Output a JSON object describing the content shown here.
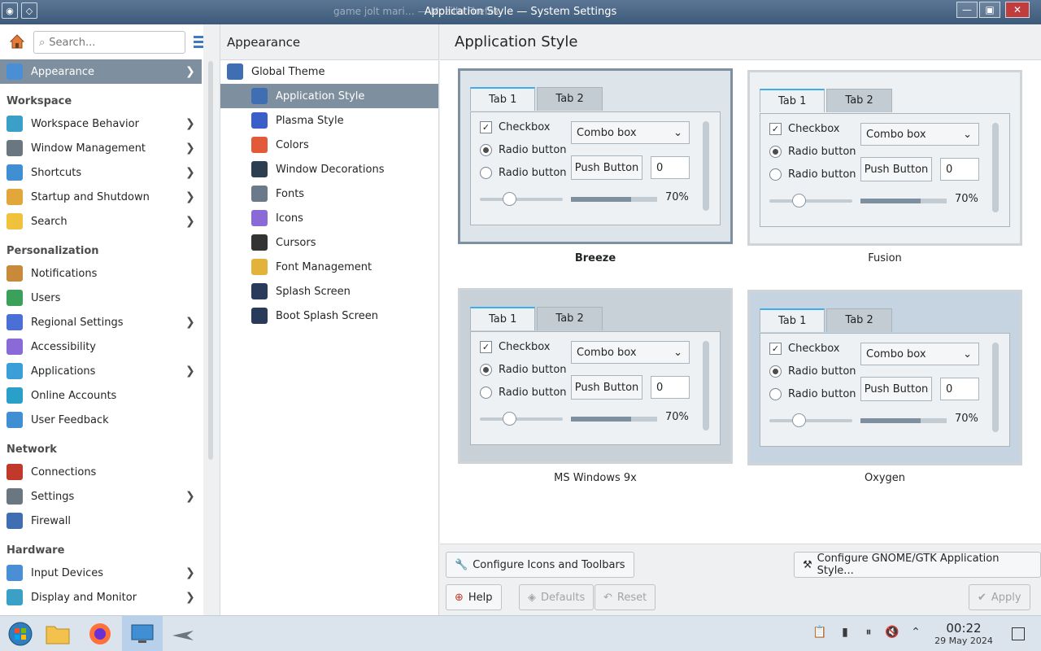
{
  "window": {
    "title": "Application Style — System Settings",
    "background_title": "game jolt mari… — Mozilla Firefox",
    "controls": {
      "minimize": "—",
      "maximize": "▣",
      "close": "✕"
    }
  },
  "sidebar": {
    "search_placeholder": "Search...",
    "items": [
      {
        "label": "Appearance",
        "active": true,
        "chevron": true,
        "icon": "appearance-icon"
      }
    ],
    "workspace_heading": "Workspace",
    "workspace": [
      {
        "label": "Workspace Behavior",
        "chevron": true,
        "icon": "workspace-behavior-icon"
      },
      {
        "label": "Window Management",
        "chevron": true,
        "icon": "window-management-icon"
      },
      {
        "label": "Shortcuts",
        "chevron": true,
        "icon": "shortcuts-icon"
      },
      {
        "label": "Startup and Shutdown",
        "chevron": true,
        "icon": "startup-icon"
      },
      {
        "label": "Search",
        "chevron": true,
        "icon": "search-settings-icon"
      }
    ],
    "personalization_heading": "Personalization",
    "personalization": [
      {
        "label": "Notifications",
        "chevron": false,
        "icon": "notifications-icon"
      },
      {
        "label": "Users",
        "chevron": false,
        "icon": "users-icon"
      },
      {
        "label": "Regional Settings",
        "chevron": true,
        "icon": "regional-icon"
      },
      {
        "label": "Accessibility",
        "chevron": false,
        "icon": "accessibility-icon"
      },
      {
        "label": "Applications",
        "chevron": true,
        "icon": "applications-icon"
      },
      {
        "label": "Online Accounts",
        "chevron": false,
        "icon": "online-accounts-icon"
      },
      {
        "label": "User Feedback",
        "chevron": false,
        "icon": "user-feedback-icon"
      }
    ],
    "network_heading": "Network",
    "network": [
      {
        "label": "Connections",
        "chevron": false,
        "icon": "connections-icon"
      },
      {
        "label": "Settings",
        "chevron": true,
        "icon": "network-settings-icon"
      },
      {
        "label": "Firewall",
        "chevron": false,
        "icon": "firewall-icon"
      }
    ],
    "hardware_heading": "Hardware",
    "hardware": [
      {
        "label": "Input Devices",
        "chevron": true,
        "icon": "input-devices-icon"
      },
      {
        "label": "Display and Monitor",
        "chevron": true,
        "icon": "display-icon"
      }
    ]
  },
  "middle": {
    "header": "Appearance",
    "items": [
      {
        "label": "Global Theme",
        "indent": false
      },
      {
        "label": "Application Style",
        "indent": true,
        "active": true
      },
      {
        "label": "Plasma Style",
        "indent": true
      },
      {
        "label": "Colors",
        "indent": true
      },
      {
        "label": "Window Decorations",
        "indent": true
      },
      {
        "label": "Fonts",
        "indent": true
      },
      {
        "label": "Icons",
        "indent": true
      },
      {
        "label": "Cursors",
        "indent": true
      },
      {
        "label": "Font Management",
        "indent": true
      },
      {
        "label": "Splash Screen",
        "indent": true
      },
      {
        "label": "Boot Splash Screen",
        "indent": true
      }
    ]
  },
  "main": {
    "header": "Application Style",
    "preview": {
      "tab1": "Tab 1",
      "tab2": "Tab 2",
      "checkbox": "Checkbox",
      "radio": "Radio button",
      "combo": "Combo box",
      "push": "Push Button",
      "spin": "0",
      "progress": "70%",
      "progress_value": 0.7
    },
    "styles": [
      {
        "name": "Breeze",
        "selected": true
      },
      {
        "name": "Fusion",
        "selected": false
      },
      {
        "name": "MS Windows 9x",
        "selected": false
      },
      {
        "name": "Oxygen",
        "selected": false
      }
    ],
    "buttons": {
      "configure_icons": "Configure Icons and Toolbars",
      "configure_gtk": "Configure GNOME/GTK Application Style...",
      "help": "Help",
      "defaults": "Defaults",
      "reset": "Reset",
      "apply": "Apply"
    }
  },
  "taskbar": {
    "time": "00:22",
    "date": "29 May 2024"
  }
}
